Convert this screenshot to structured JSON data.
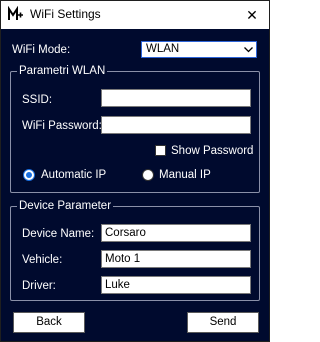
{
  "window": {
    "title": "WiFi Settings",
    "close_glyph": "✕",
    "logo_icon": "m-logo-icon"
  },
  "wifi_mode": {
    "label": "WiFi Mode:",
    "selected": "WLAN"
  },
  "wlan_group": {
    "legend": "Parametri WLAN",
    "ssid_label": "SSID:",
    "ssid_value": "",
    "password_label": "WiFi Password:",
    "password_value": "",
    "show_password_label": "Show Password",
    "show_password_checked": false,
    "automatic_ip_label": "Automatic IP",
    "manual_ip_label": "Manual IP",
    "ip_mode": "automatic"
  },
  "device_group": {
    "legend": "Device Parameter",
    "name_label": "Device Name:",
    "name_value": "Corsaro",
    "vehicle_label": "Vehicle:",
    "vehicle_value": "Moto 1",
    "driver_label": "Driver:",
    "driver_value": "Luke"
  },
  "buttons": {
    "back": "Back",
    "send": "Send"
  },
  "colors": {
    "background": "#000a2e",
    "accent": "#1a6fe0",
    "field": "#ffffff"
  }
}
